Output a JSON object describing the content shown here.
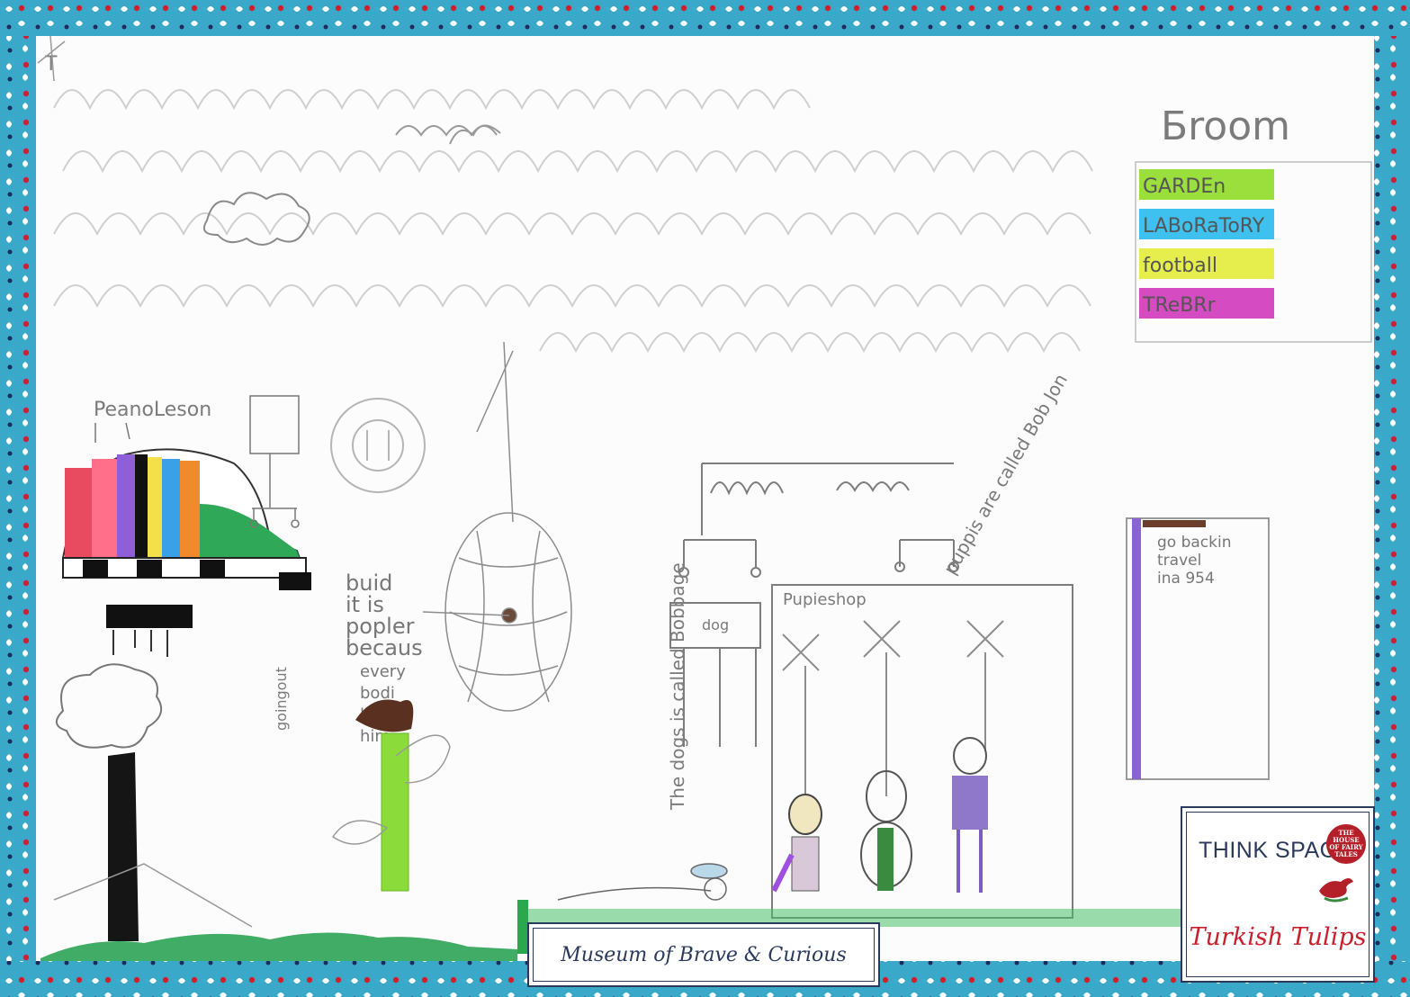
{
  "drawing": {
    "corner_note": "T",
    "top_right_word": "Бroom",
    "legend": [
      {
        "text": "GARDEn",
        "color": "#9adf3c"
      },
      {
        "text": "LABoRaToRY",
        "color": "#3ec1ef"
      },
      {
        "text": "football",
        "color": "#e6ee4e"
      },
      {
        "text": "TReBRr",
        "color": "#d54cc2"
      }
    ],
    "piano_label": "PeanoLeson",
    "build_note": [
      "buid",
      "it is",
      "popler",
      "becaus",
      "every",
      "bodi",
      "like",
      "him"
    ],
    "side_note": "goingout",
    "dogs_note": "The dogs is called",
    "dogs_note_end": "Bobbage",
    "puppies_note": "puppis are called Bob Jon",
    "puppie_shop": "Pupieshop",
    "travel_note": [
      "go backin",
      "travel",
      "ina 954"
    ],
    "signs": "dog"
  },
  "labels": {
    "museum_title": "Museum of Brave & Curious",
    "think_space": "THINK SPACE",
    "house_badge": [
      "THE",
      "HOUSE",
      "OF FAIRY",
      "TALES"
    ],
    "turkish_tulips": "Turkish Tulips"
  },
  "colors": {
    "border": "#3aa9c9",
    "navy": "#2b3a5c",
    "red": "#c8202e",
    "grass": "#1f9e4a"
  }
}
